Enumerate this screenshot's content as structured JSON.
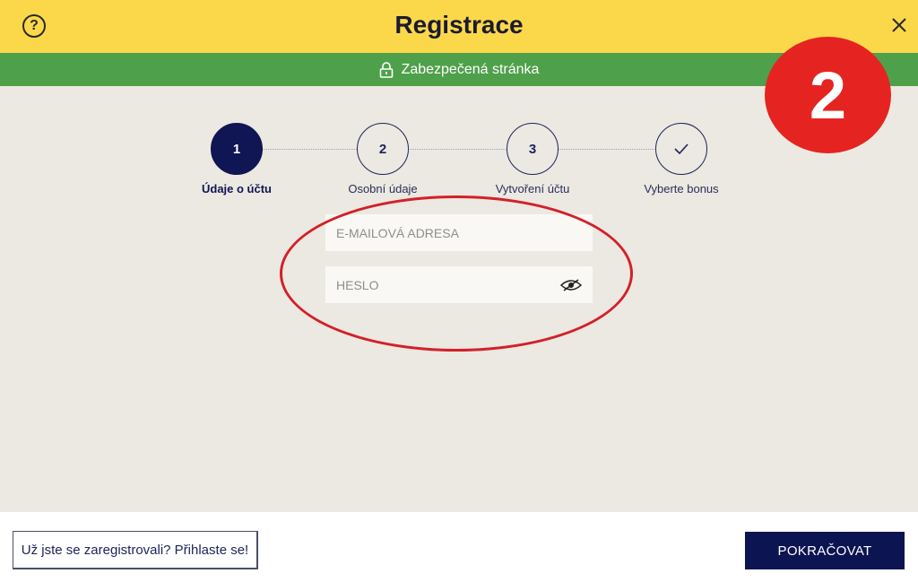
{
  "header": {
    "title": "Registrace",
    "help_icon": "question-circle-icon",
    "help_glyph": "?",
    "close_icon": "close-icon"
  },
  "secure_bar": {
    "text": "Zabezpečená stránka",
    "icon": "lock-icon"
  },
  "steps": [
    {
      "number": "1",
      "label": "Údaje o účtu",
      "active": true
    },
    {
      "number": "2",
      "label": "Osobní údaje",
      "active": false
    },
    {
      "number": "3",
      "label": "Vytvoření účtu",
      "active": false
    },
    {
      "number": "",
      "label": "Vyberte bonus",
      "active": false,
      "icon": "check-icon"
    }
  ],
  "form": {
    "email": {
      "placeholder": "E-MAILOVÁ ADRESA",
      "value": ""
    },
    "password": {
      "placeholder": "HESLO",
      "value": "",
      "icon": "eye-slash-icon"
    }
  },
  "annotation": {
    "badge_number": "2"
  },
  "footer": {
    "login_label": "Už jste se zaregistrovali? Přihlaste se!",
    "continue_label": "POKRAČOVAT"
  },
  "colors": {
    "header_bg": "#fbd84a",
    "secure_bg": "#4fa04a",
    "navy": "#101553",
    "annotation_red": "#e52421"
  }
}
